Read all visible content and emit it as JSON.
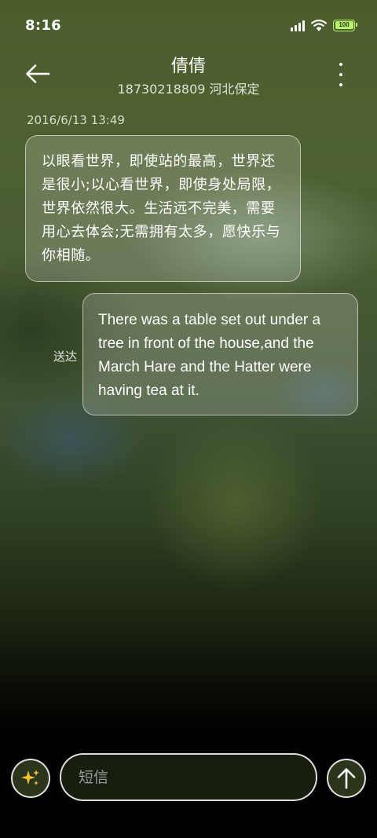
{
  "status_bar": {
    "time": "8:16",
    "battery_label": "100",
    "icons": [
      "signal-icon",
      "wifi-icon",
      "battery-icon"
    ],
    "battery_color": "#b8f26c"
  },
  "header": {
    "back_icon": "arrow-left-icon",
    "contact_name": "倩倩",
    "contact_subtitle": "18730218809 河北保定",
    "more_icon": "more-vertical-icon"
  },
  "conversation": {
    "timestamp": "2016/6/13 13:49",
    "messages": [
      {
        "direction": "incoming",
        "text": "以眼看世界，即使站的最高，世界还是很小;以心看世界，即使身处局限，世界依然很大。生活远不完美，需要用心去体会;无需拥有太多，愿快乐与你相随。"
      },
      {
        "direction": "outgoing",
        "text": "There was a table set out under a tree in front of the house,and the March Hare and the Hatter were having tea at it.",
        "status": "送达"
      }
    ]
  },
  "composer": {
    "magic_icon": "sparkles-icon",
    "placeholder": "短信",
    "value": "",
    "send_icon": "arrow-up-icon"
  }
}
